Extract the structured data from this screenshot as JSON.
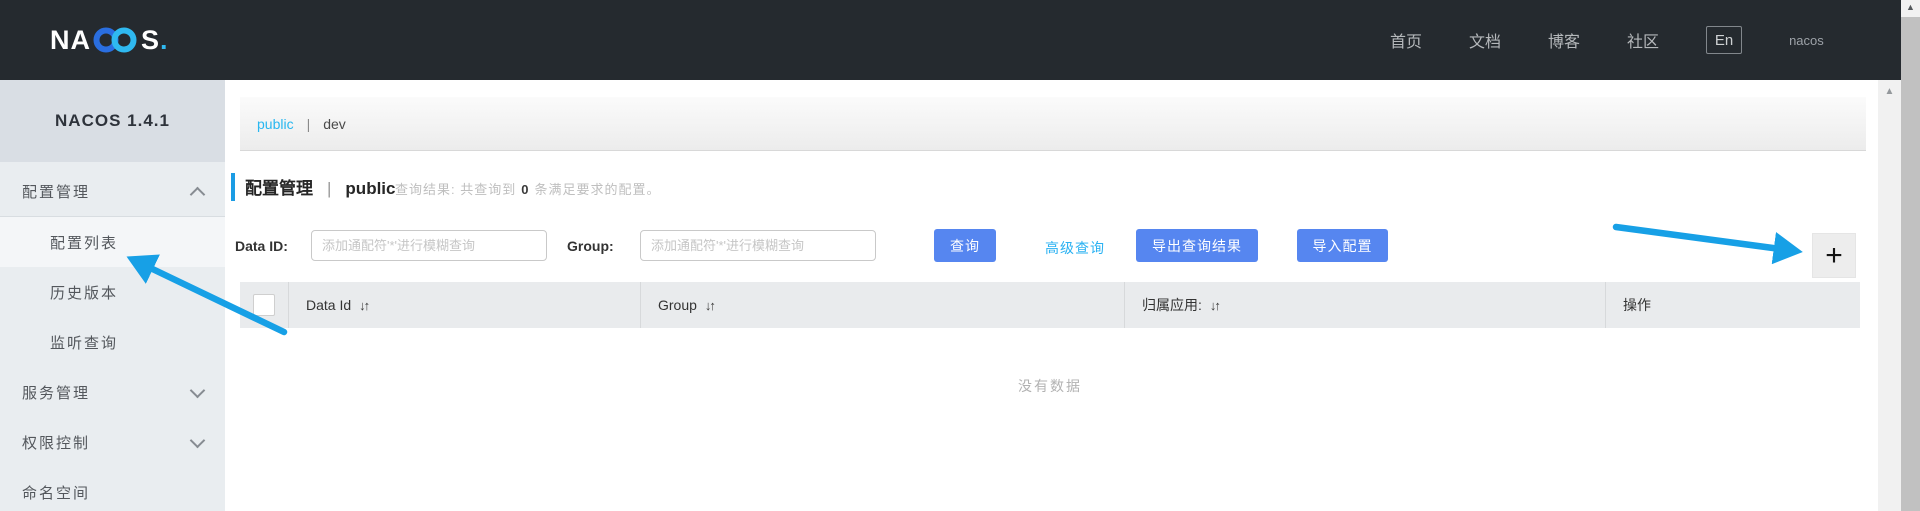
{
  "topbar": {
    "logo": {
      "part1": "NA",
      "part2": "S",
      "dot": "."
    },
    "nav": [
      {
        "label": "首页"
      },
      {
        "label": "文档"
      },
      {
        "label": "博客"
      },
      {
        "label": "社区"
      }
    ],
    "lang_button": "En",
    "user": "nacos"
  },
  "sidebar": {
    "version": "NACOS 1.4.1",
    "items": [
      {
        "label": "配置管理"
      },
      {
        "label": "配置列表"
      },
      {
        "label": "历史版本"
      },
      {
        "label": "监听查询"
      },
      {
        "label": "服务管理"
      },
      {
        "label": "权限控制"
      },
      {
        "label": "命名空间"
      }
    ]
  },
  "breadcrumb": {
    "namespace": "public",
    "separator": "|",
    "env": "dev"
  },
  "page_header": {
    "title": "配置管理",
    "separator": "|",
    "namespace": "public",
    "result_prefix": "查询结果: 共查询到",
    "result_count": "0",
    "result_suffix": "条满足要求的配置。"
  },
  "filters": {
    "data_id_label": "Data ID:",
    "data_id_placeholder": "添加通配符'*'进行模糊查询",
    "group_label": "Group:",
    "group_placeholder": "添加通配符'*'进行模糊查询",
    "search_button": "查询",
    "advanced_query_link": "高级查询",
    "export_button": "导出查询结果",
    "import_button": "导入配置",
    "add_button": "+"
  },
  "table": {
    "columns": [
      {
        "label": "Data Id"
      },
      {
        "label": "Group"
      },
      {
        "label": "归属应用:"
      },
      {
        "label": "操作"
      }
    ],
    "sort_icon": "↓↑",
    "empty_text": "没有数据"
  },
  "icons": {
    "scroll_up": "▲"
  },
  "colors": {
    "header_bg": "#252a2f",
    "accent_blue": "#5686f0",
    "link_cyan": "#29b1f2",
    "title_accent": "#1b9ce4",
    "annotation_arrow": "#17a0e6",
    "sidebar_bg": "#e9edf0"
  }
}
